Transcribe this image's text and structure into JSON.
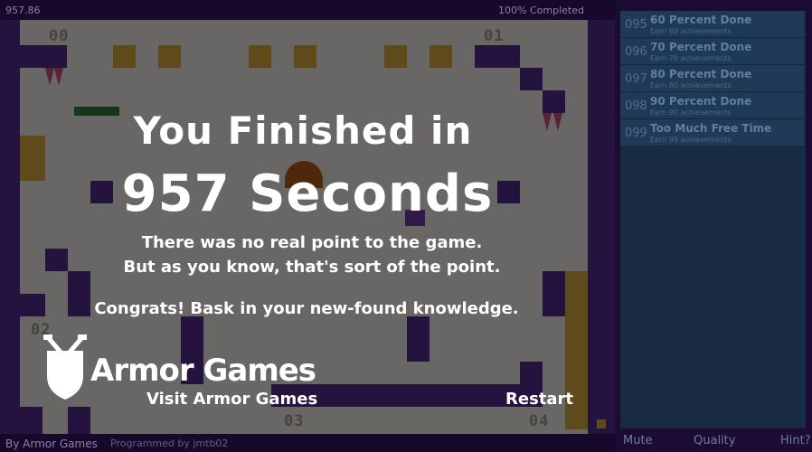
{
  "hud": {
    "timer": "957.86",
    "completed": "100% Completed",
    "by_armor": "By Armor Games",
    "programmed": "Programmed by jmtb02"
  },
  "rooms": [
    "00",
    "01",
    "02",
    "03",
    "04"
  ],
  "achievements": [
    {
      "num": "095",
      "title": "60 Percent Done",
      "desc": "Earn 60 achievements"
    },
    {
      "num": "096",
      "title": "70 Percent Done",
      "desc": "Earn 70 achievements"
    },
    {
      "num": "097",
      "title": "80 Percent Done",
      "desc": "Earn 80 achievements"
    },
    {
      "num": "098",
      "title": "90 Percent Done",
      "desc": "Earn 90 achievements"
    },
    {
      "num": "099",
      "title": "Too Much Free Time",
      "desc": "Earn 99 achievements"
    }
  ],
  "sidebar": {
    "mute": "Mute",
    "quality": "Quality",
    "hint": "Hint?"
  },
  "final": {
    "line1": "You Finished in",
    "line2": "957 Seconds",
    "msg1": "There was no real point to the game.",
    "msg2": "But as you know, that's sort of the point.",
    "msg3": "Congrats!  Bask in your new-found knowledge.",
    "brand": "Armor Games",
    "visit": "Visit Armor Games",
    "restart": "Restart"
  },
  "colors": {
    "wall": "#4e2a8a",
    "floor": "#e9e4df",
    "hazard": "#d0a43a",
    "panel": "#1f3a56"
  }
}
